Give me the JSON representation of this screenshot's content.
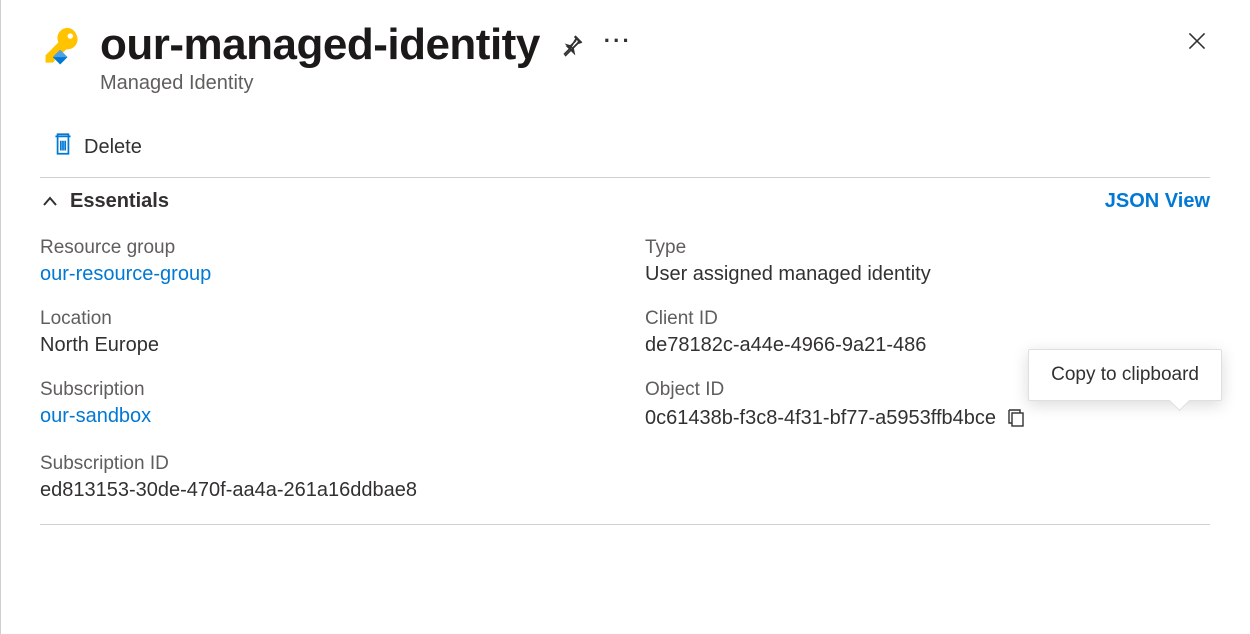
{
  "header": {
    "title": "our-managed-identity",
    "subtitle": "Managed Identity"
  },
  "toolbar": {
    "delete_label": "Delete"
  },
  "essentials": {
    "section_title": "Essentials",
    "json_view_label": "JSON View",
    "left": [
      {
        "label": "Resource group",
        "value": "our-resource-group",
        "link": true
      },
      {
        "label": "Location",
        "value": "North Europe",
        "link": false
      },
      {
        "label": "Subscription",
        "value": "our-sandbox",
        "link": true
      },
      {
        "label": "Subscription ID",
        "value": "ed813153-30de-470f-aa4a-261a16ddbae8",
        "link": false
      }
    ],
    "right": [
      {
        "label": "Type",
        "value": "User assigned managed identity",
        "copy": false
      },
      {
        "label": "Client ID",
        "value": "de78182c-a44e-4966-9a21-486",
        "copy": false
      },
      {
        "label": "Object ID",
        "value": "0c61438b-f3c8-4f31-bf77-a5953ffb4bce",
        "copy": true
      }
    ]
  },
  "tooltip": {
    "copy_label": "Copy to clipboard"
  },
  "icons": {
    "key": "key-icon",
    "pin": "pin-icon",
    "more": "more-icon",
    "close": "close-icon",
    "trash": "trash-icon",
    "chevron_up": "chevron-up-icon",
    "copy": "copy-icon"
  }
}
